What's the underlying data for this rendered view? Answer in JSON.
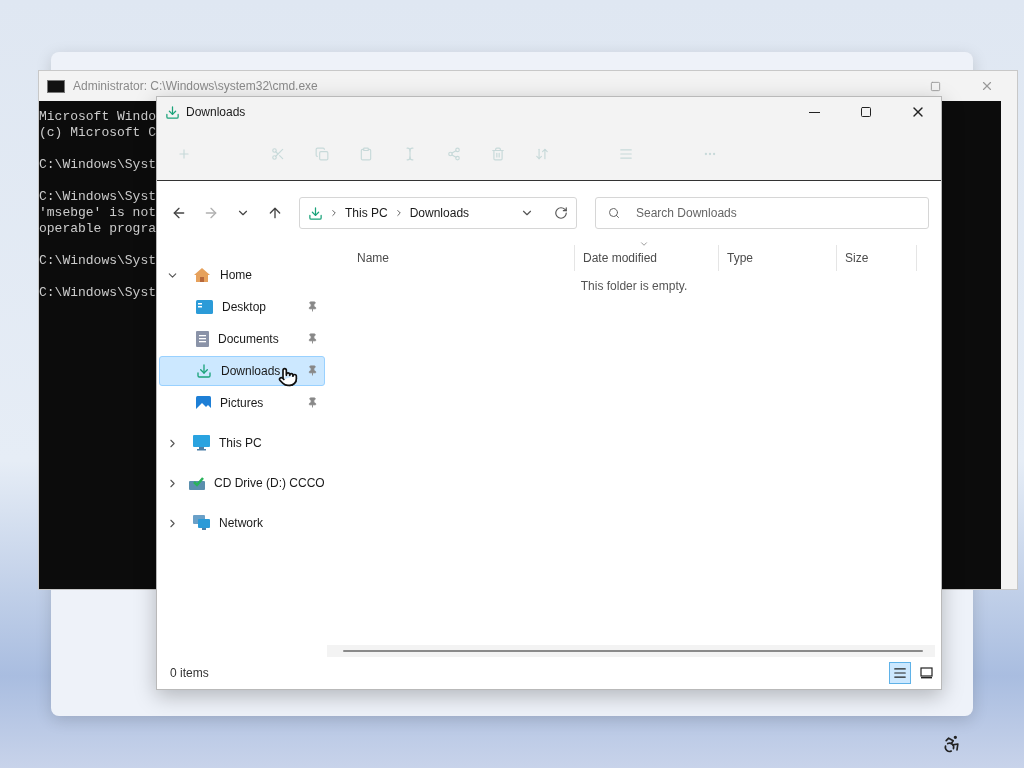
{
  "console_window": {
    "title": "Administrator: C:\\Windows\\system32\\cmd.exe",
    "blocks": [
      [
        "Microsoft Windo",
        "(c) Microsoft C"
      ],
      [
        "C:\\Windows\\Syst"
      ],
      [
        "C:\\Windows\\Syst",
        "'msebge' is not",
        "operable progra"
      ],
      [
        "C:\\Windows\\Syst"
      ],
      [
        "C:\\Windows\\Syst"
      ]
    ]
  },
  "explorer": {
    "title": "Downloads",
    "nav_buttons": [
      {
        "kind": "back",
        "disabled": false
      },
      {
        "kind": "forward",
        "disabled": true
      },
      {
        "kind": "recent",
        "disabled": false
      },
      {
        "kind": "up",
        "disabled": false
      }
    ],
    "address": {
      "segments": [
        "This PC",
        "Downloads"
      ]
    },
    "search": {
      "placeholder": "Search Downloads"
    },
    "sidebar": {
      "items": [
        {
          "label": "Home",
          "kind": "home",
          "expanded": true,
          "selected": false,
          "children": [
            {
              "label": "Desktop",
              "kind": "desktop",
              "pinned": true,
              "selected": false
            },
            {
              "label": "Documents",
              "kind": "documents",
              "pinned": true,
              "selected": false
            },
            {
              "label": "Downloads",
              "kind": "downloads",
              "pinned": true,
              "selected": true
            },
            {
              "label": "Pictures",
              "kind": "pictures",
              "pinned": true,
              "selected": false
            }
          ]
        },
        {
          "label": "This PC",
          "kind": "pc",
          "expanded": false,
          "selected": false
        },
        {
          "label": "CD Drive (D:) CCCO",
          "kind": "cd",
          "expanded": false,
          "selected": false
        },
        {
          "label": "Network",
          "kind": "network",
          "expanded": false,
          "selected": false
        }
      ]
    },
    "columns": [
      {
        "label": "Name",
        "sorted": false
      },
      {
        "label": "Date modified",
        "sorted": true
      },
      {
        "label": "Type",
        "sorted": false
      },
      {
        "label": "Size",
        "sorted": false
      }
    ],
    "empty_message": "This folder is empty.",
    "status_bar": {
      "count": "0 items"
    },
    "views": [
      {
        "kind": "details",
        "selected": true
      },
      {
        "kind": "tiles",
        "selected": false
      }
    ]
  }
}
